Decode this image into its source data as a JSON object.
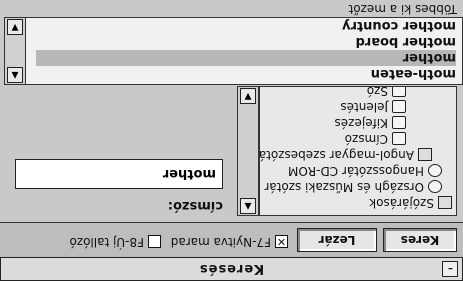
{
  "window": {
    "title": "Keresés"
  },
  "toolbar": {
    "search_button": "Keres",
    "close_button": "Lezár",
    "keep_open_label": "F7-Nyitva marad",
    "keep_open_checked": true,
    "new_toggle_label": "F8-Új tallózó",
    "new_toggle_checked": false
  },
  "tree": {
    "items": [
      {
        "label": "Szójárások",
        "icon": "book-icon"
      },
      {
        "label": "Országh és Műszaki szótár",
        "icon": "cd-icon"
      },
      {
        "label": "Hangosszótár CD-ROM",
        "icon": "cd-icon"
      },
      {
        "label": "Angol-magyar szebeszótár",
        "icon": "book-icon"
      },
      {
        "label": "Címszó",
        "icon": "tag-icon"
      },
      {
        "label": "Kifejezés",
        "icon": "tag-icon"
      },
      {
        "label": "Jelentés",
        "icon": "tag-icon"
      },
      {
        "label": "Szó",
        "icon": "tag-icon"
      }
    ]
  },
  "right": {
    "label": "címszó:",
    "value": "mother"
  },
  "results": {
    "items": [
      "moth-eaten",
      "mother",
      "mother board",
      "mother country"
    ],
    "selected_index": 1
  },
  "footer": {
    "label": "Többes ki a mezőt"
  }
}
